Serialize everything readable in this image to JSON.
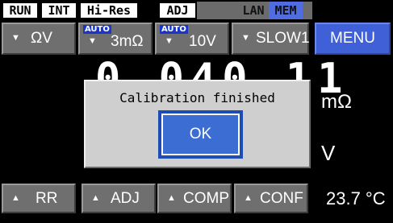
{
  "status_bar": {
    "run": "RUN",
    "int": "INT",
    "hires": "Hi-Res",
    "adj": "ADJ",
    "lan": "LAN",
    "mem": "MEM"
  },
  "top_buttons": {
    "range": {
      "label": "ΩV"
    },
    "current": {
      "auto": "AUTO",
      "label": "3mΩ"
    },
    "voltage": {
      "auto": "AUTO",
      "label": "10V"
    },
    "speed": {
      "label": "SLOW1"
    },
    "menu": {
      "label": "MENU"
    }
  },
  "display": {
    "reading": "0.040 11",
    "resistance_unit": "mΩ",
    "voltage_unit": "V",
    "temperature": "23.7 °C"
  },
  "dialog": {
    "message": "Calibration finished",
    "ok_label": "OK"
  },
  "bottom_buttons": {
    "rr": "RR",
    "adj": "ADJ",
    "comp": "COMP",
    "conf": "CONF"
  },
  "icons": {
    "dropdown": "triangle-down-icon",
    "expand": "triangle-up-icon"
  }
}
